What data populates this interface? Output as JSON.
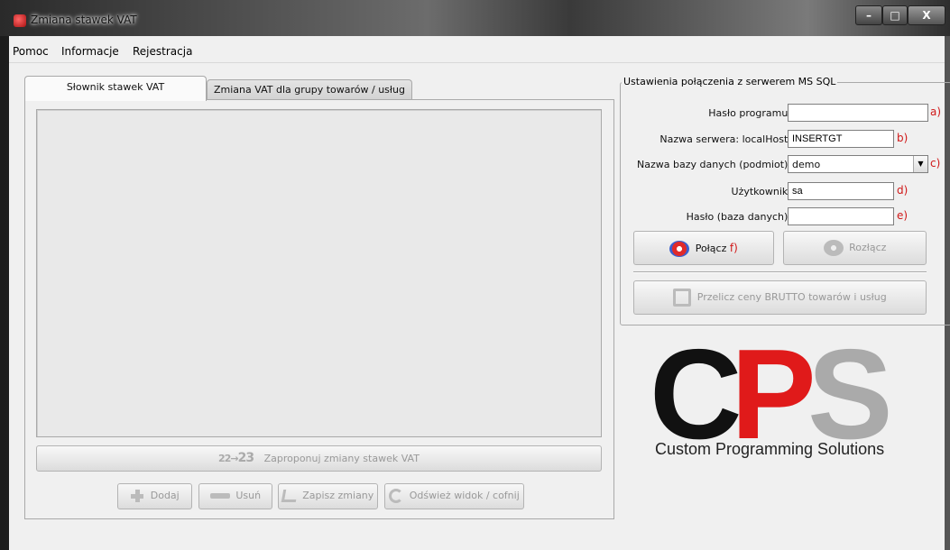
{
  "window": {
    "title": "Zmiana stawek VAT",
    "min_label": "–",
    "max_label": "□",
    "close_label": "X"
  },
  "menu": {
    "items": [
      "Pomoc",
      "Informacje",
      "Rejestracja"
    ]
  },
  "tabs": [
    "Słownik stawek VAT",
    "Zmiana VAT dla grupy towarów / usług"
  ],
  "left_panel": {
    "propose_icon_text_a": "22",
    "propose_icon_text_b": "23",
    "propose_label": "Zaproponuj zmiany stawek VAT",
    "add_label": "Dodaj",
    "delete_label": "Usuń",
    "save_label": "Zapisz zmiany",
    "refresh_label": "Odśwież widok / cofnij"
  },
  "connection": {
    "legend": "Ustawienia połączenia z serwerem MS SQL",
    "fields": {
      "program_password": {
        "label": "Hasło programu:",
        "value": "",
        "marker": "a)"
      },
      "server": {
        "label": "Nazwa serwera: localHost\\",
        "value": "INSERTGT",
        "marker": "b)"
      },
      "database": {
        "label": "Nazwa bazy danych (podmiot):",
        "value": "demo",
        "marker": "c)"
      },
      "user": {
        "label": "Użytkownik:",
        "value": "sa",
        "marker": "d)"
      },
      "db_password": {
        "label": "Hasło (baza danych):",
        "value": "",
        "marker": "e)"
      }
    },
    "connect_label": "Połącz",
    "connect_marker": "f)",
    "disconnect_label": "Rozłącz",
    "recalc_label": "Przelicz ceny BRUTTO towarów i usług"
  },
  "logo": {
    "letter_c": "C",
    "letter_p": "P",
    "letter_s": "S",
    "tagline": "Custom Programming Solutions"
  },
  "colors": {
    "marker_red": "#d01818",
    "logo_dark": "#111111",
    "logo_red": "#e01a1a",
    "logo_gray": "#aaaaaa"
  }
}
